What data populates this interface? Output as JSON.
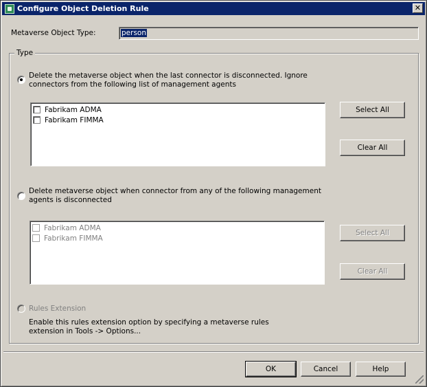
{
  "window": {
    "title": "Configure Object Deletion Rule",
    "close_glyph": "✕"
  },
  "metaverse": {
    "label": "Metaverse Object Type:",
    "value": "person"
  },
  "type_group": {
    "legend": "Type",
    "option1": {
      "text": "Delete the metaverse object when the last connector is disconnected. Ignore connectors from the following list of management agents",
      "selected": true,
      "agents": [
        "Fabrikam ADMA",
        "Fabrikam FIMMA"
      ],
      "select_all": "Select All",
      "clear_all": "Clear All"
    },
    "option2": {
      "text": "Delete metaverse object when connector from any of the following management agents is disconnected",
      "selected": false,
      "agents": [
        "Fabrikam ADMA",
        "Fabrikam FIMMA"
      ],
      "select_all": "Select All",
      "clear_all": "Clear All"
    },
    "option3": {
      "label": "Rules Extension",
      "help": "Enable this rules extension option by specifying a metaverse rules extension in Tools -> Options..."
    }
  },
  "footer": {
    "ok": "OK",
    "cancel": "Cancel",
    "help": "Help"
  },
  "colors": {
    "title_bar": "#0a246a",
    "face": "#d4d0c8",
    "disabled_text": "#808080"
  }
}
